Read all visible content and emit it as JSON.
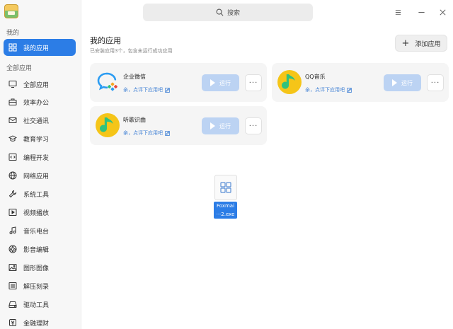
{
  "sidebar": {
    "group_mine": "我的",
    "my_apps": "我的应用",
    "group_all": "全部应用",
    "items": [
      {
        "label": "全部应用",
        "icon": "monitor-icon"
      },
      {
        "label": "效率办公",
        "icon": "briefcase-icon"
      },
      {
        "label": "社交通讯",
        "icon": "mail-icon"
      },
      {
        "label": "教育学习",
        "icon": "graduation-cap-icon"
      },
      {
        "label": "编程开发",
        "icon": "code-icon"
      },
      {
        "label": "网络应用",
        "icon": "globe-icon"
      },
      {
        "label": "系统工具",
        "icon": "wrench-icon"
      },
      {
        "label": "视频播放",
        "icon": "video-icon"
      },
      {
        "label": "音乐电台",
        "icon": "music-note-icon"
      },
      {
        "label": "影音编辑",
        "icon": "film-reel-icon"
      },
      {
        "label": "图形图像",
        "icon": "image-icon"
      },
      {
        "label": "解压刻录",
        "icon": "archive-icon"
      },
      {
        "label": "驱动工具",
        "icon": "drive-icon"
      },
      {
        "label": "金融理财",
        "icon": "finance-icon"
      }
    ]
  },
  "header": {
    "search_placeholder": "搜索"
  },
  "main": {
    "title": "我的应用",
    "subtitle": "已安装应用3个，包含未运行成功应用",
    "add_label": "添加应用",
    "run_label": "运行",
    "more_label": "···",
    "rate_label": "亲，点评下应用吧",
    "apps": [
      {
        "name": "企业微信",
        "icon": "wecom-icon"
      },
      {
        "name": "QQ音乐",
        "icon": "qq-music-icon"
      },
      {
        "name": "听歌识曲",
        "icon": "song-recognition-icon"
      }
    ]
  },
  "desktop_file": {
    "line1": "Foxmai",
    "line2": "···2.exe"
  },
  "colors": {
    "accent": "#2c7de6",
    "run_disabled": "#bcd3f3",
    "music_yellow": "#f5c518",
    "music_green": "#31c27c"
  }
}
